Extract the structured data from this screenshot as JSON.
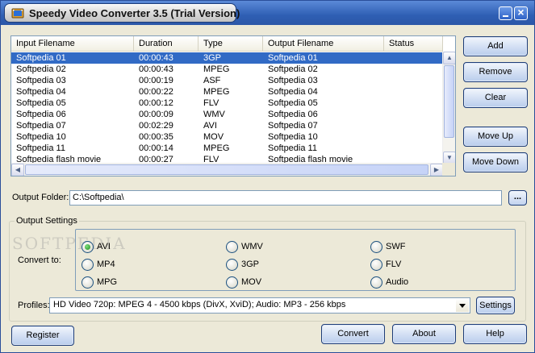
{
  "window": {
    "title": "Speedy Video Converter 3.5 (Trial Version)"
  },
  "file_list": {
    "columns": [
      "Input Filename",
      "Duration",
      "Type",
      "Output Filename",
      "Status"
    ],
    "rows": [
      {
        "input": "Softpedia 01",
        "duration": "00:00:43",
        "type": "3GP",
        "output": "Softpedia 01",
        "status": "",
        "selected": true
      },
      {
        "input": "Softpedia 02",
        "duration": "00:00:43",
        "type": "MPEG",
        "output": "Softpedia 02",
        "status": ""
      },
      {
        "input": "Softpedia 03",
        "duration": "00:00:19",
        "type": "ASF",
        "output": "Softpedia 03",
        "status": ""
      },
      {
        "input": "Softpedia 04",
        "duration": "00:00:22",
        "type": "MPEG",
        "output": "Softpedia 04",
        "status": ""
      },
      {
        "input": "Softpedia 05",
        "duration": "00:00:12",
        "type": "FLV",
        "output": "Softpedia 05",
        "status": ""
      },
      {
        "input": "Softpedia 06",
        "duration": "00:00:09",
        "type": "WMV",
        "output": "Softpedia 06",
        "status": ""
      },
      {
        "input": "Softpedia 07",
        "duration": "00:02:29",
        "type": "AVI",
        "output": "Softpedia 07",
        "status": ""
      },
      {
        "input": "Softpedia 10",
        "duration": "00:00:35",
        "type": "MOV",
        "output": "Softpedia 10",
        "status": ""
      },
      {
        "input": "Softpedia 11",
        "duration": "00:00:14",
        "type": "MPEG",
        "output": "Softpedia 11",
        "status": ""
      },
      {
        "input": "Softpedia flash movie",
        "duration": "00:00:27",
        "type": "FLV",
        "output": "Softpedia flash movie",
        "status": ""
      }
    ]
  },
  "side_buttons": {
    "add": "Add",
    "remove": "Remove",
    "clear": "Clear",
    "move_up": "Move Up",
    "move_down": "Move Down"
  },
  "output_folder": {
    "label": "Output Folder:",
    "value": "C:\\Softpedia\\",
    "browse_label": "..."
  },
  "output_settings": {
    "group_label": "Output Settings",
    "convert_to_label": "Convert to:",
    "watermark": "SOFTPEDIA",
    "formats": [
      "AVI",
      "MP4",
      "MPG",
      "WMV",
      "3GP",
      "MOV",
      "SWF",
      "FLV",
      "Audio"
    ],
    "selected_format": "AVI",
    "profiles_label": "Profiles:",
    "profile_value": "HD Video 720p: MPEG 4 - 4500 kbps (DivX, XviD); Audio: MP3 - 256 kbps",
    "settings_label": "Settings"
  },
  "bottom_buttons": {
    "register": "Register",
    "convert": "Convert",
    "about": "About",
    "help": "Help"
  },
  "colors": {
    "titlebar": "#2f5fb4",
    "selection": "#316ac5",
    "window_bg": "#ece9d8"
  }
}
